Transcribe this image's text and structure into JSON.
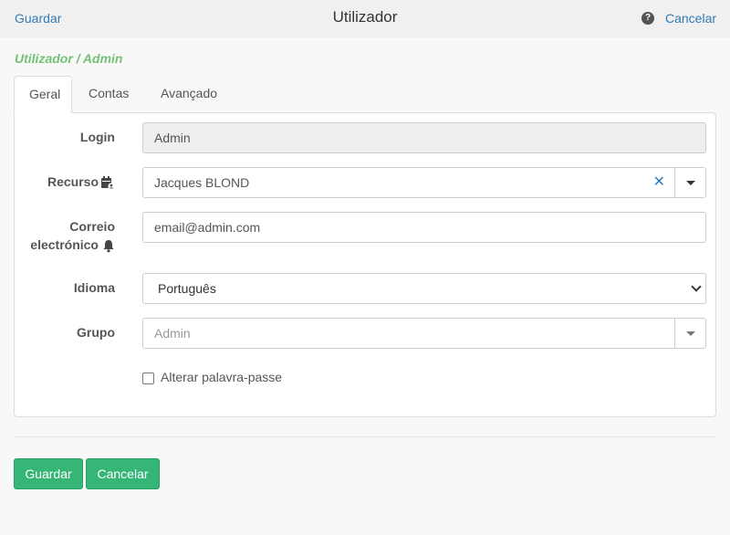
{
  "header": {
    "save_link": "Guardar",
    "title": "Utilizador",
    "help_glyph": "?",
    "cancel_link": "Cancelar"
  },
  "breadcrumb": "Utilizador / Admin",
  "tabs": [
    {
      "label": "Geral",
      "active": true
    },
    {
      "label": "Contas",
      "active": false
    },
    {
      "label": "Avançado",
      "active": false
    }
  ],
  "form": {
    "login": {
      "label": "Login",
      "value": "Admin"
    },
    "resource": {
      "label": "Recurso",
      "value": "Jacques BLOND",
      "clear_glyph": "✕"
    },
    "email": {
      "label_line1": "Correio",
      "label_line2": "electrónico",
      "value": "email@admin.com"
    },
    "language": {
      "label": "Idioma",
      "value": "Português"
    },
    "group": {
      "label": "Grupo",
      "placeholder": "Admin"
    },
    "change_password": {
      "label": "Alterar palavra-passe",
      "checked": false
    }
  },
  "footer": {
    "save_button": "Guardar",
    "cancel_button": "Cancelar"
  },
  "colors": {
    "link": "#337ab7",
    "breadcrumb": "#5cb85c",
    "button": "#35b677"
  },
  "icons": {
    "resource": "calendar-user-icon",
    "email": "bell-icon",
    "help": "question-circle-icon"
  }
}
